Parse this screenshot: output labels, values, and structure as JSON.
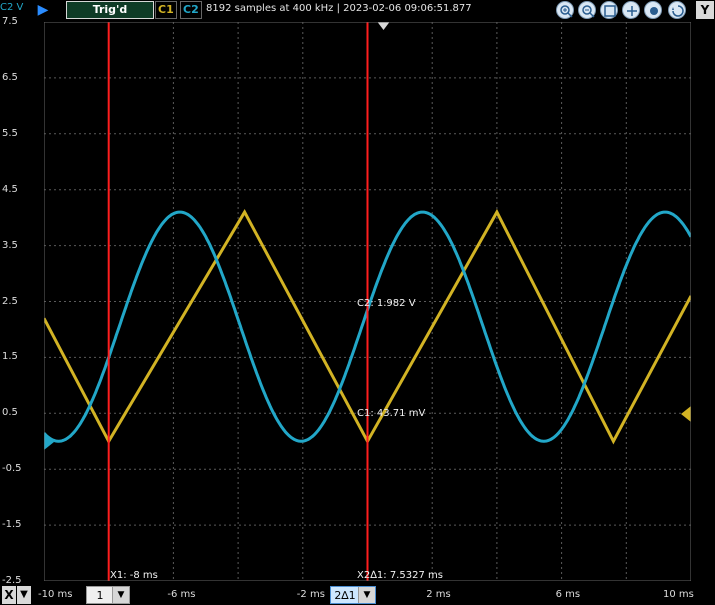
{
  "header": {
    "unit_label": "C2 V",
    "trigger_state": "Trig'd",
    "channels": [
      {
        "label": "C1",
        "color": "#d2b324"
      },
      {
        "label": "C2",
        "color": "#22a7c8"
      }
    ],
    "status": "8192 samples at 400 kHz | 2023-02-06 09:06:51.877",
    "tools": [
      "zoom-in-icon",
      "zoom-out-icon",
      "fit-icon",
      "pan-icon",
      "hand-icon",
      "zoom-reset-icon"
    ],
    "y_button": "Y"
  },
  "axes": {
    "y_ticks": [
      "7.5",
      "6.5",
      "5.5",
      "4.5",
      "3.5",
      "2.5",
      "1.5",
      "0.5",
      "-0.5",
      "-1.5",
      "-2.5"
    ],
    "x_ticks": [
      "-10 ms",
      "-6 ms",
      "-2 ms",
      "2 ms",
      "6 ms",
      "10 ms"
    ]
  },
  "footer": {
    "x_button": "X",
    "x_down": "▼",
    "select_1": "1",
    "select_2": "2∆1"
  },
  "cursors": {
    "x1_label": "X1: -8 ms",
    "x2_label": "X2∆1: 7.5327 ms",
    "c2_value": "C2: 1.982 V",
    "c1_value": "C1: 43.71 mV"
  },
  "colors": {
    "c1": "#d2b324",
    "c2": "#22a7c8",
    "cursor": "#ff1e1e"
  },
  "chart_data": {
    "type": "line",
    "x_range_ms": [
      -10,
      10
    ],
    "y_range_v": [
      -2.5,
      7.5
    ],
    "grid": true,
    "series": [
      {
        "name": "C1",
        "shape": "triangle",
        "x_ms": [
          -10,
          -8,
          -3.8,
          0.0,
          4.0,
          7.6,
          10
        ],
        "y_v": [
          2.2,
          0.0,
          4.1,
          0.0,
          4.1,
          0.0,
          2.6
        ]
      },
      {
        "name": "C2",
        "shape": "sine",
        "min_v": 0.0,
        "max_v": 4.1,
        "period_ms": 7.5,
        "peak_ms": -5.8
      }
    ],
    "cursor_x_ms": [
      -8,
      0.0
    ]
  }
}
